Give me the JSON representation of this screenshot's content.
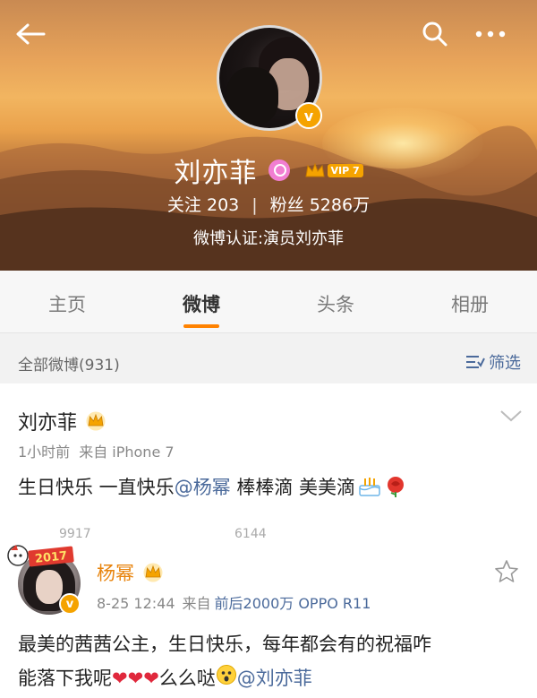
{
  "profile": {
    "name": "刘亦菲",
    "vip_label": "VIP 7",
    "verified_badge": "v",
    "following_label": "关注",
    "following_count": "203",
    "fans_label": "粉丝",
    "fans_count": "5286万",
    "separator": "|",
    "verification": "微博认证:演员刘亦菲"
  },
  "tabs": [
    {
      "label": "主页",
      "active": false
    },
    {
      "label": "微博",
      "active": true
    },
    {
      "label": "头条",
      "active": false
    },
    {
      "label": "相册",
      "active": false
    }
  ],
  "feed": {
    "all_label": "全部微博(931)",
    "filter_label": "筛选"
  },
  "post": {
    "author": "刘亦菲",
    "time": "1小时前",
    "source": "来自 iPhone 7",
    "text_before": "生日快乐 一直快乐",
    "mention": "@杨幂",
    "text_after": " 棒棒滴 美美滴",
    "actions": [
      "9917",
      "6144"
    ]
  },
  "comment": {
    "sticker": "2017",
    "author": "杨幂",
    "verified_badge": "v",
    "time": "8-25 12:44",
    "source_prefix": "来自",
    "device": "前后2000万 OPPO R11",
    "text_line1": "最美的茜茜公主，生日快乐，每年都会有的祝福咋",
    "text_line2_before": "能落下我呢",
    "hearts": "❤❤❤",
    "text_line2_after": "么么哒",
    "mention": "@刘亦菲"
  },
  "colors": {
    "accent": "#ff8200",
    "link": "#4b6a9b",
    "vip": "#f5a300",
    "comment_author": "#e8840e"
  },
  "icons": [
    "back-arrow-icon",
    "search-icon",
    "more-icon",
    "female-icon",
    "crown-icon",
    "filter-icon",
    "chevron-down-icon",
    "cake-emoji-icon",
    "rose-emoji-icon",
    "star-icon",
    "shocked-emoji-icon"
  ]
}
